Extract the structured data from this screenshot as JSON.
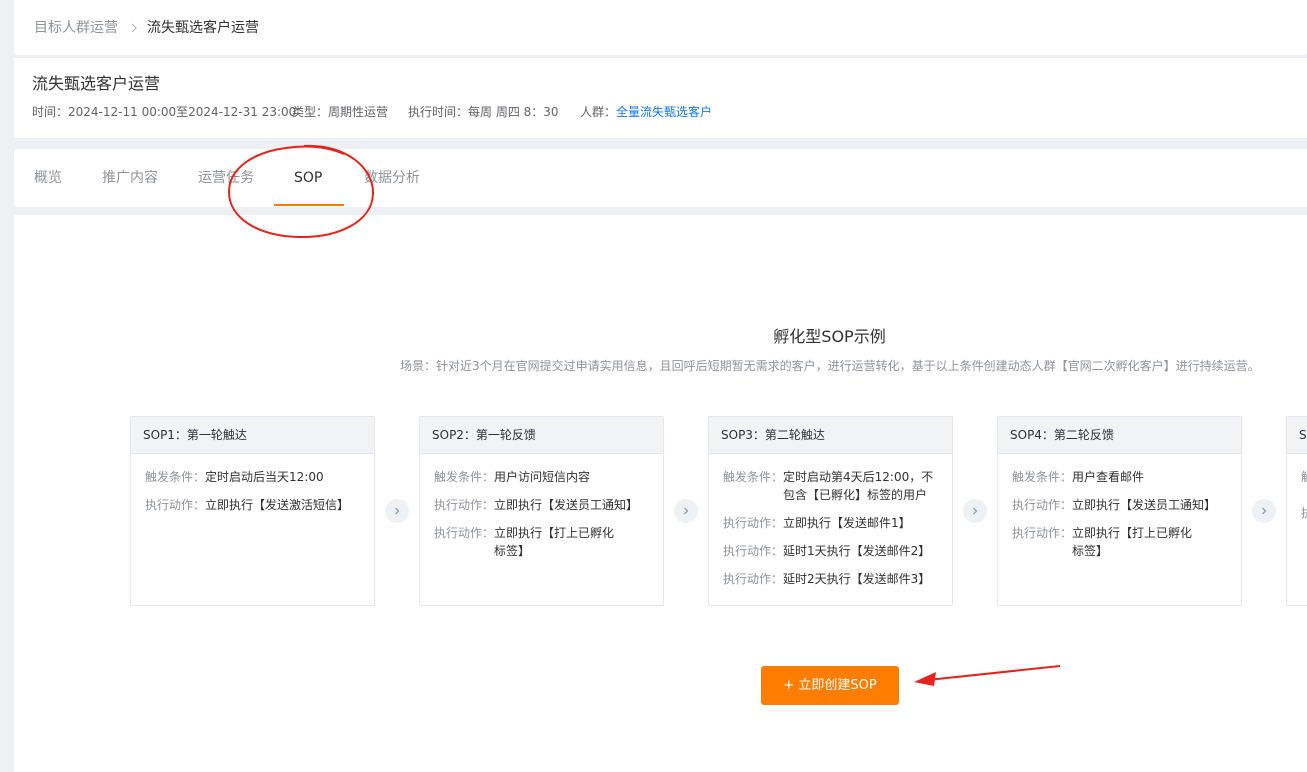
{
  "breadcrumb": {
    "parent": "目标人群运营",
    "current": "流失甄选客户运营"
  },
  "header": {
    "title": "流失甄选客户运营",
    "meta": {
      "time_label": "时间：",
      "time_value": "2024-12-11 00:00至2024-12-31 23:00",
      "type_label": "类型：",
      "type_value": "周期性运营",
      "exec_label": "执行时间：",
      "exec_value": "每周 周四  8：30",
      "crowd_label": "人群：",
      "crowd_value": "全量流失甄选客户"
    }
  },
  "tabs": [
    {
      "label": "概览"
    },
    {
      "label": "推广内容"
    },
    {
      "label": "运营任务"
    },
    {
      "label": "SOP"
    },
    {
      "label": "数据分析"
    }
  ],
  "active_tab": "SOP",
  "sop": {
    "heading": "孵化型SOP示例",
    "scene": "场景：针对近3个月在官网提交过申请实用信息，且回呼后短期暂无需求的客户，进行运营转化，基于以上条件创建动态人群【官网二次孵化客户】进行持续运营。",
    "cards": [
      {
        "title": "SOP1：第一轮触达",
        "rows": [
          {
            "label": "触发条件：",
            "value": "定时启动后当天12:00"
          },
          {
            "label": "执行动作：",
            "value": "立即执行【发送激活短信】"
          }
        ]
      },
      {
        "title": "SOP2：第一轮反馈",
        "rows": [
          {
            "label": "触发条件：",
            "value": "用户访问短信内容"
          },
          {
            "label": "执行动作：",
            "value": "立即执行【发送员工通知】"
          },
          {
            "label": "执行动作：",
            "value": "立即执行【打上已孵化标签】"
          }
        ]
      },
      {
        "title": "SOP3：第二轮触达",
        "rows": [
          {
            "label": "触发条件：",
            "value": "定时启动第4天后12:00，不包含【已孵化】标签的用户"
          },
          {
            "label": "执行动作：",
            "value": "立即执行【发送邮件1】"
          },
          {
            "label": "执行动作：",
            "value": "延时1天执行【发送邮件2】"
          },
          {
            "label": "执行动作：",
            "value": "延时2天执行【发送邮件3】"
          }
        ]
      },
      {
        "title": "SOP4：第二轮反馈",
        "rows": [
          {
            "label": "触发条件：",
            "value": "用户查看邮件"
          },
          {
            "label": "执行动作：",
            "value": "立即执行【发送员工通知】"
          },
          {
            "label": "执行动作：",
            "value": "立即执行【打上已孵化标签】"
          }
        ]
      },
      {
        "title": "S",
        "rows": [
          {
            "label": "触",
            "value": ""
          },
          {
            "label": "执",
            "value": ""
          }
        ]
      }
    ],
    "create_button": "+ 立即创建SOP"
  },
  "colors": {
    "accent": "#ff7d00",
    "link": "#1677ff",
    "annotation": "#e8221b"
  }
}
